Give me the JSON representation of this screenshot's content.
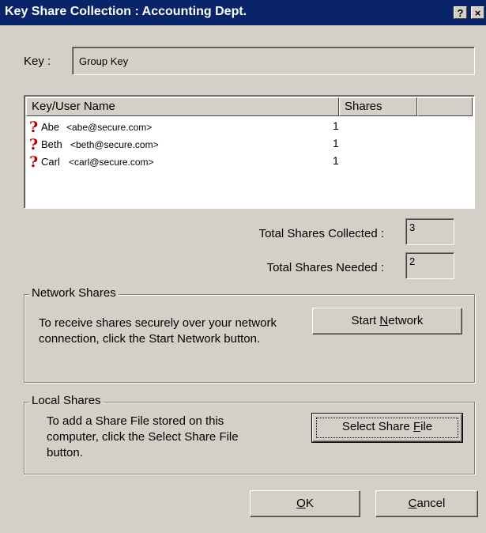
{
  "window": {
    "title": "Key Share Collection : Accounting Dept.",
    "help_glyph": "?",
    "close_glyph": "×"
  },
  "key": {
    "label": "Key :",
    "value": "Group Key"
  },
  "list": {
    "columns": [
      "Key/User Name",
      "Shares",
      ""
    ],
    "rows": [
      {
        "name": "Abe",
        "email": "<abe@secure.com>",
        "shares": "1",
        "icon": "question-icon"
      },
      {
        "name": "Beth",
        "email": "<beth@secure.com>",
        "shares": "1",
        "icon": "question-icon"
      },
      {
        "name": "Carl",
        "email": "<carl@secure.com>",
        "shares": "1",
        "icon": "question-icon"
      }
    ]
  },
  "totals": {
    "collected_label": "Total Shares Collected :",
    "collected_value": "3",
    "needed_label": "Total Shares Needed :",
    "needed_value": "2"
  },
  "network": {
    "legend": "Network Shares",
    "description": "To receive shares securely over your network connection, click the Start Network button.",
    "button_pre": "Start ",
    "button_mnemonic": "N",
    "button_post": "etwork"
  },
  "local": {
    "legend": "Local Shares",
    "description": "To add a Share File stored on this computer, click the Select Share File button.",
    "button_pre": "Select Share ",
    "button_mnemonic": "F",
    "button_post": "ile"
  },
  "footer": {
    "ok_mnemonic": "O",
    "ok_post": "K",
    "cancel_mnemonic": "C",
    "cancel_post": "ancel"
  },
  "colors": {
    "title_bar": "#0a246a",
    "dialog_bg": "#d4d0c8",
    "question_icon": "#b80000"
  }
}
